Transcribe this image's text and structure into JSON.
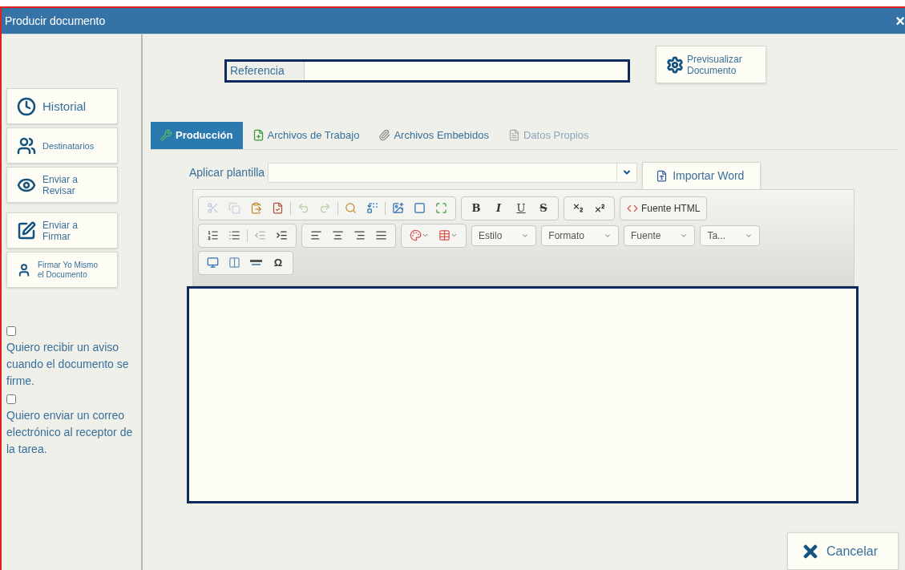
{
  "window": {
    "title": "Producir documento",
    "close": "×"
  },
  "sidebar": {
    "buttons": [
      {
        "kind": "clock",
        "label": "Historial"
      },
      {
        "kind": "users",
        "label": "Destinatarios"
      },
      {
        "kind": "eye",
        "label": "Enviar a Revisar"
      },
      {
        "kind": "sign",
        "label": "Enviar a Firmar"
      },
      {
        "kind": "user",
        "label": "Firmar Yo Mismo el Documento"
      }
    ],
    "options": [
      {
        "label": "Quiero recibir un aviso cuando el documento se firme.",
        "checked": false
      },
      {
        "label": "Quiero enviar un correo electrónico al receptor de la tarea.",
        "checked": false
      }
    ]
  },
  "reference": {
    "label": "Referencia"
  },
  "preview_button": {
    "label": "Previsualizar Documento"
  },
  "tabs": [
    {
      "kind": "tools",
      "label": "Producción",
      "selected": true,
      "disabled": false
    },
    {
      "kind": "fileplus",
      "label": "Archivos de Trabajo",
      "selected": false,
      "disabled": false
    },
    {
      "kind": "clip",
      "label": "Archivos Embebidos",
      "selected": false,
      "disabled": false
    },
    {
      "kind": "data",
      "label": "Datos Propios",
      "selected": false,
      "disabled": true
    }
  ],
  "template": {
    "label": "Aplicar plantilla"
  },
  "import_button": {
    "label": "Importar Word"
  },
  "toolbar": {
    "lines": [
      {
        "groups": [
          {
            "items": [
              {
                "kind": "cut",
                "disabled": true
              },
              {
                "kind": "copy",
                "disabled": true
              },
              {
                "kind": "paste",
                "disabled": false
              },
              {
                "kind": "pasteword",
                "disabled": false
              },
              {
                "kind": "sep"
              },
              {
                "kind": "undo",
                "disabled": true
              },
              {
                "kind": "redo",
                "disabled": true
              },
              {
                "kind": "sep"
              },
              {
                "kind": "find",
                "disabled": false
              },
              {
                "kind": "replace",
                "disabled": false
              },
              {
                "kind": "sep"
              },
              {
                "kind": "image",
                "disabled": false
              },
              {
                "kind": "frame",
                "disabled": false
              },
              {
                "kind": "maximize",
                "disabled": false
              }
            ]
          },
          {
            "items": [
              {
                "kind": "bold",
                "label": "B"
              },
              {
                "kind": "italic",
                "label": "I"
              },
              {
                "kind": "underline",
                "label": "U"
              },
              {
                "kind": "strike",
                "label": "S"
              }
            ]
          },
          {
            "items": [
              {
                "kind": "subscript",
                "disabled": false
              },
              {
                "kind": "superscript",
                "disabled": false
              }
            ]
          },
          {
            "items": [
              {
                "kind": "source",
                "label": "Fuente HTML"
              }
            ]
          }
        ]
      },
      {
        "groups": [
          {
            "items": [
              {
                "kind": "numlist",
                "disabled": false
              },
              {
                "kind": "bullist",
                "disabled": false
              },
              {
                "kind": "sep"
              },
              {
                "kind": "outdent",
                "disabled": true
              },
              {
                "kind": "indent",
                "disabled": false
              }
            ]
          },
          {
            "items": [
              {
                "kind": "alignleft",
                "disabled": false
              },
              {
                "kind": "aligncenter",
                "disabled": false
              },
              {
                "kind": "alignright",
                "disabled": false
              },
              {
                "kind": "justify",
                "disabled": false
              }
            ]
          },
          {
            "items": [
              {
                "kind": "color",
                "disabled": false
              },
              {
                "kind": "table",
                "disabled": false
              }
            ]
          },
          {
            "items": [
              {
                "kind": "dropdown",
                "label": "Estilo"
              }
            ]
          },
          {
            "items": [
              {
                "kind": "dropdown",
                "label": "Formato"
              }
            ]
          },
          {
            "items": [
              {
                "kind": "dropdown",
                "label": "Fuente"
              }
            ]
          },
          {
            "items": [
              {
                "kind": "dropdown",
                "label": "Ta..."
              }
            ]
          }
        ]
      },
      {
        "groups": [
          {
            "items": [
              {
                "kind": "template",
                "disabled": false
              },
              {
                "kind": "page",
                "disabled": false
              },
              {
                "kind": "hline",
                "disabled": false
              },
              {
                "kind": "symbol",
                "label": "Ω"
              }
            ]
          }
        ]
      }
    ]
  },
  "cancel_button": {
    "label": "Cancelar"
  }
}
